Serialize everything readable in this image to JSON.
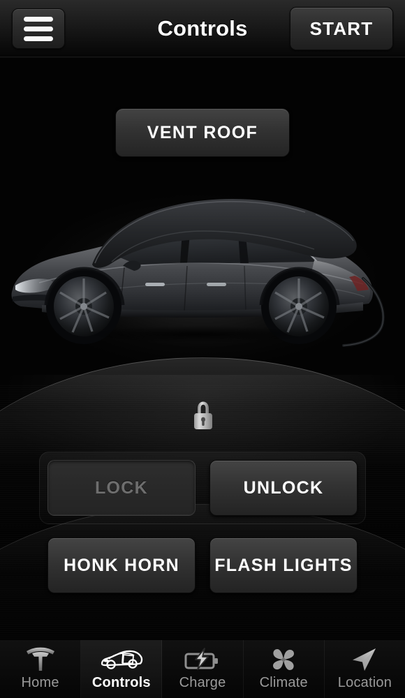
{
  "app": {
    "screen_title": "Controls",
    "background_color": "#000000",
    "accent_color": "#ffffff"
  },
  "header": {
    "title": "Controls",
    "menu_icon": "hamburger-menu-icon",
    "start_label": "START"
  },
  "main": {
    "vent_roof_label": "VENT ROOF",
    "vehicle_image": "tesla-model-s-side-view",
    "lock_status_icon": "padlock-locked-icon",
    "buttons": [
      {
        "id": "lock",
        "label": "LOCK",
        "state": "disabled"
      },
      {
        "id": "unlock",
        "label": "UNLOCK",
        "state": "enabled"
      },
      {
        "id": "honk",
        "label": "HONK HORN",
        "state": "enabled"
      },
      {
        "id": "flash",
        "label": "FLASH LIGHTS",
        "state": "enabled"
      }
    ]
  },
  "tabbar": {
    "tabs": [
      {
        "label": "Home",
        "icon": "tesla-logo-icon",
        "active": false
      },
      {
        "label": "Controls",
        "icon": "car-icon",
        "active": true
      },
      {
        "label": "Charge",
        "icon": "battery-bolt-icon",
        "active": false
      },
      {
        "label": "Climate",
        "icon": "fan-icon",
        "active": false
      },
      {
        "label": "Location",
        "icon": "navigation-arrow-icon",
        "active": false
      }
    ]
  }
}
